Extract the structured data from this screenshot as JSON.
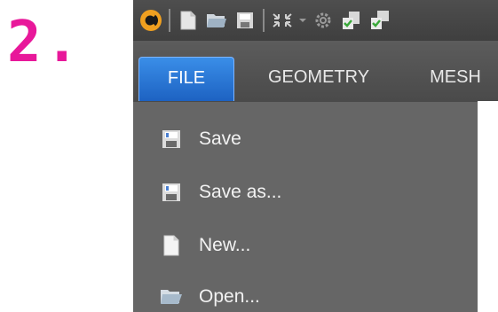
{
  "step": {
    "label": "2."
  },
  "toolbar": {
    "icons": [
      "app-logo-icon",
      "new-file-icon",
      "open-folder-icon",
      "save-icon",
      "collapse-icon",
      "settings-icon",
      "check-list-icon",
      "check-list-units-icon"
    ]
  },
  "tabs": [
    {
      "label": "FILE",
      "active": true
    },
    {
      "label": "GEOMETRY",
      "active": false
    },
    {
      "label": "MESH",
      "active": false
    }
  ],
  "file_menu": {
    "items": [
      {
        "label": "Save",
        "icon": "save-icon"
      },
      {
        "label": "Save as...",
        "icon": "save-as-icon"
      },
      {
        "label": "New...",
        "icon": "new-file-icon"
      },
      {
        "label": "Open...",
        "icon": "open-folder-icon"
      }
    ]
  },
  "colors": {
    "step_accent": "#e8189a",
    "tab_active": "#1d62c2",
    "panel_bg": "#666666",
    "toolbar_bg": "#444444"
  }
}
